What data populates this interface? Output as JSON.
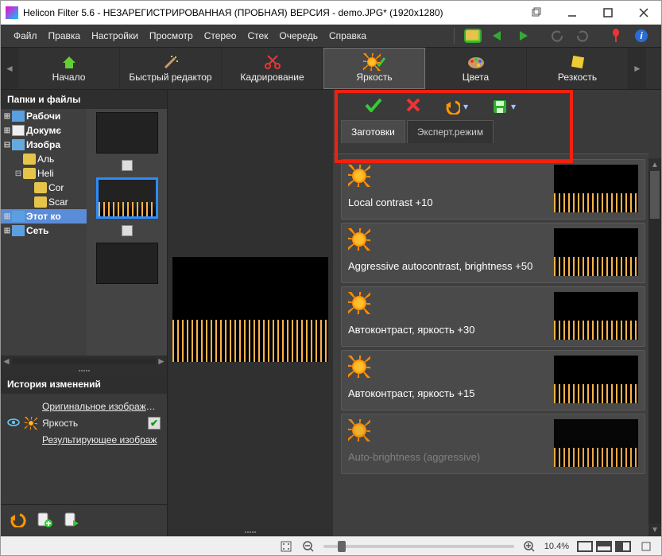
{
  "window": {
    "title": "Helicon Filter 5.6 - НЕЗАРЕГИСТРИРОВАННАЯ (ПРОБНАЯ) ВЕРСИЯ - demo.JPG* (1920x1280)"
  },
  "menu": {
    "items": [
      "Файл",
      "Правка",
      "Настройки",
      "Просмотр",
      "Стерео",
      "Стек",
      "Очередь",
      "Справка"
    ]
  },
  "bigtabs": {
    "items": [
      {
        "label": "Начало",
        "icon": "home"
      },
      {
        "label": "Быстрый редактор",
        "icon": "wand"
      },
      {
        "label": "Кадрирование",
        "icon": "scissors"
      },
      {
        "label": "Яркость",
        "icon": "sun",
        "selected": true
      },
      {
        "label": "Цвета",
        "icon": "palette"
      },
      {
        "label": "Резкость",
        "icon": "square"
      }
    ]
  },
  "leftPanel": {
    "foldersTitle": "Папки и файлы",
    "tree": [
      {
        "exp": "+",
        "bold": true,
        "icon": "comp",
        "label": "Рабочи"
      },
      {
        "exp": "+",
        "bold": true,
        "icon": "doc",
        "label": "Докумє",
        "indent": 0
      },
      {
        "exp": "−",
        "bold": true,
        "icon": "pic",
        "label": "Изобра",
        "indent": 0
      },
      {
        "exp": "",
        "bold": false,
        "icon": "folder",
        "label": "Аль",
        "indent": 1
      },
      {
        "exp": "−",
        "bold": false,
        "icon": "folder",
        "label": "Heli",
        "indent": 1
      },
      {
        "exp": "",
        "bold": false,
        "icon": "folder",
        "label": "Cor",
        "indent": 2
      },
      {
        "exp": "",
        "bold": false,
        "icon": "folder",
        "label": "Scar",
        "indent": 2
      },
      {
        "exp": "+",
        "bold": true,
        "icon": "comp",
        "label": "Этот ко",
        "indent": 0,
        "selected": true
      },
      {
        "exp": "+",
        "bold": true,
        "icon": "net",
        "label": "Сеть",
        "indent": 0
      }
    ],
    "historyTitle": "История изменений",
    "history": {
      "original": "Оригинальное изображени",
      "step1": "Яркость",
      "result": "Результирующее изображ"
    }
  },
  "rightPanel": {
    "tabs": {
      "presets": "Заготовки",
      "expert": "Эксперт.режим"
    },
    "presets": [
      {
        "name": "Local contrast +10"
      },
      {
        "name": "Aggressive autocontrast, brightness +50"
      },
      {
        "name": "Автоконтраст, яркость +30"
      },
      {
        "name": "Автоконтраст, яркость +15"
      },
      {
        "name": "Auto-brightness (aggressive)"
      }
    ]
  },
  "status": {
    "zoom": "10.4%"
  }
}
